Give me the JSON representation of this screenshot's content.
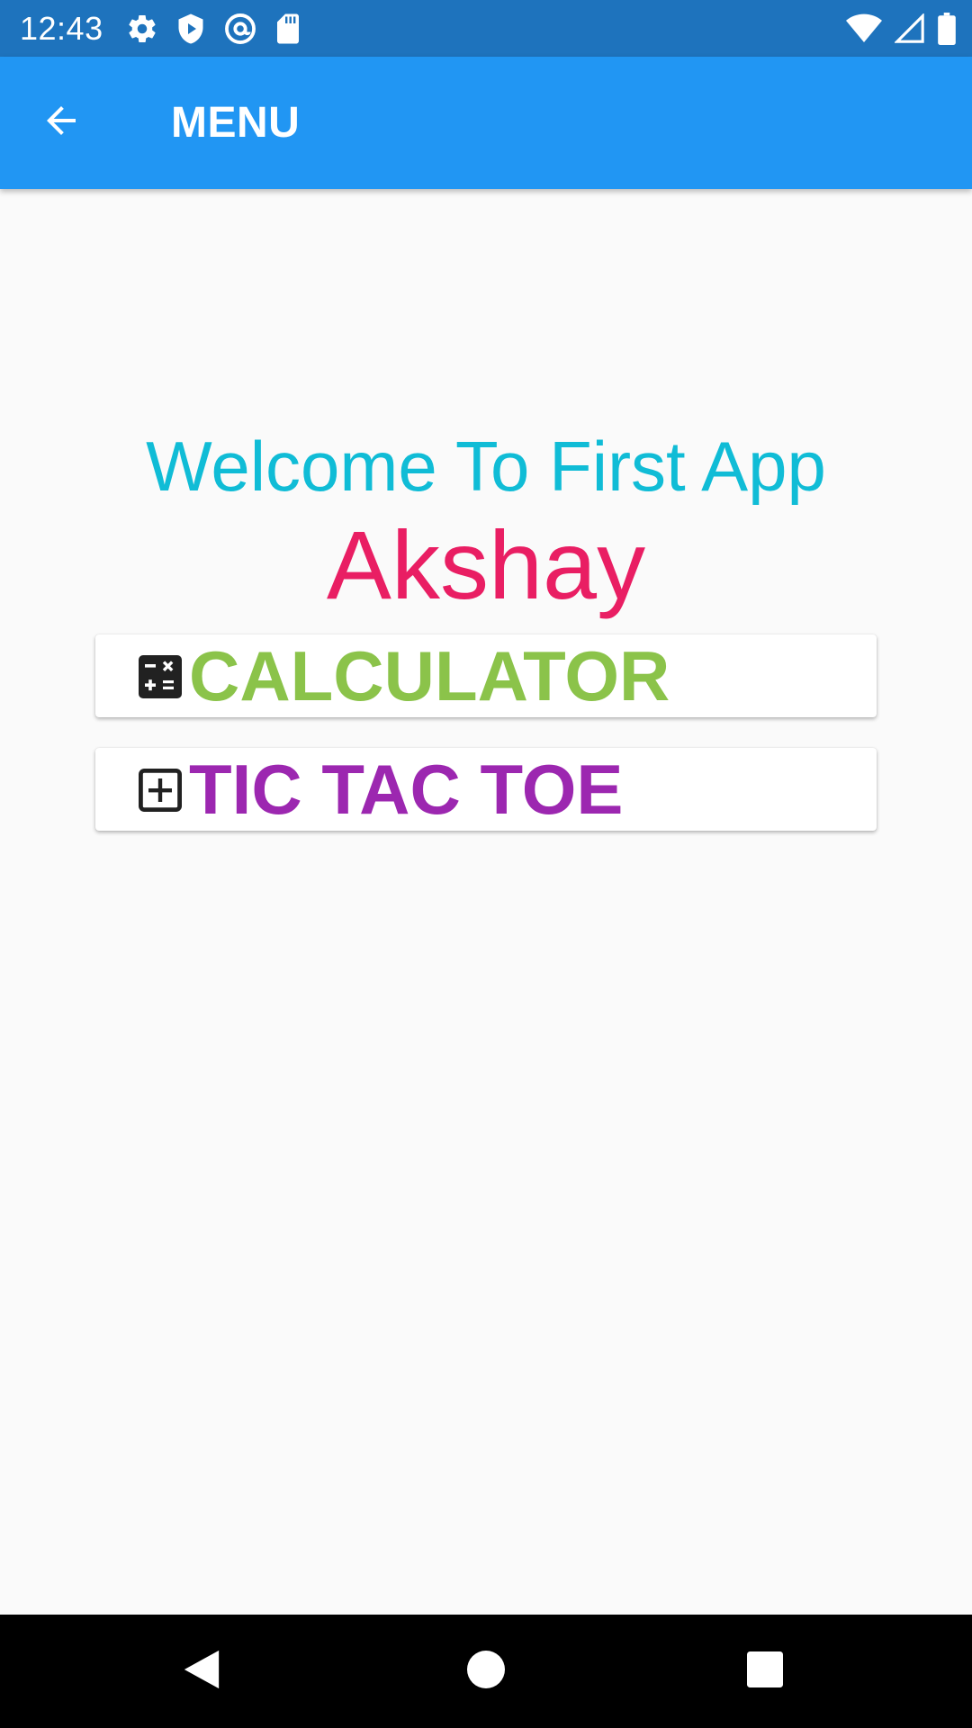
{
  "status_bar": {
    "time": "12:43",
    "left_icons": [
      "gear-icon",
      "shield-play-icon",
      "at-sign-icon",
      "sd-card-icon"
    ],
    "right_icons": [
      "wifi-icon",
      "signal-icon",
      "battery-icon"
    ],
    "background": "#1e73bd"
  },
  "app_bar": {
    "title": "MENU",
    "back_icon": "arrow-back-icon",
    "background": "#2196f3"
  },
  "content": {
    "welcome": "Welcome To First App",
    "name": "Akshay",
    "welcome_color": "#10bcd6",
    "name_color": "#e91e63",
    "items": [
      {
        "label": "CALCULATOR",
        "icon": "calculator-icon",
        "color": "#8bc34a"
      },
      {
        "label": "TIC TAC TOE",
        "icon": "plus-box-icon",
        "color": "#9c27b0"
      }
    ]
  },
  "nav_bar": {
    "buttons": [
      "back-triangle-icon",
      "home-circle-icon",
      "recents-square-icon"
    ]
  }
}
